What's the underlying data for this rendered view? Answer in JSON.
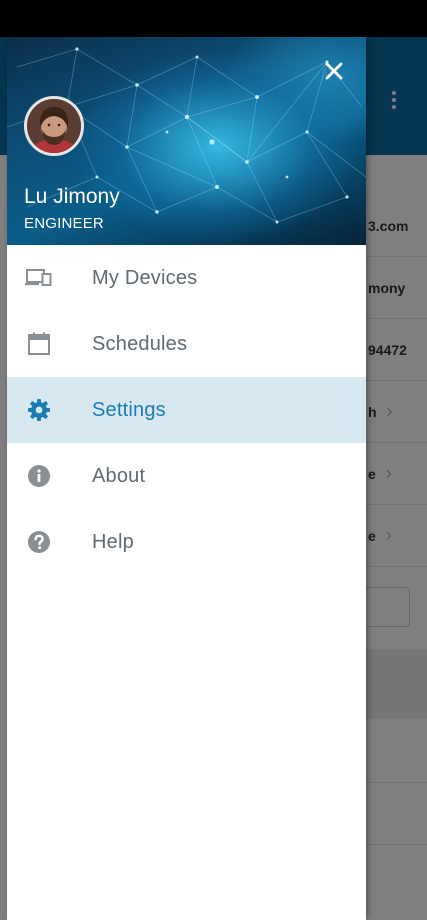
{
  "background": {
    "rows": [
      {
        "text": "3.com"
      },
      {
        "text": "mony"
      },
      {
        "text": "94472"
      },
      {
        "text": "h",
        "chevron": "›"
      },
      {
        "text": "e",
        "chevron": "›"
      },
      {
        "text": "e",
        "chevron": "›"
      }
    ]
  },
  "drawer": {
    "header": {
      "user_name": "Lu Jimony",
      "user_role": "ENGINEER",
      "close_icon": "close-icon"
    },
    "menu": [
      {
        "label": "My Devices",
        "icon": "devices-icon",
        "active": false
      },
      {
        "label": "Schedules",
        "icon": "calendar-icon",
        "active": false
      },
      {
        "label": "Settings",
        "icon": "gear-icon",
        "active": true
      },
      {
        "label": "About",
        "icon": "info-icon",
        "active": false
      },
      {
        "label": "Help",
        "icon": "help-icon",
        "active": false
      }
    ]
  },
  "colors": {
    "accent": "#1c7bb4",
    "active_bg": "#d8e8f1",
    "icon_gray": "#8a8f93",
    "text_gray": "#5f6b73",
    "app_bar": "#0a6aa1"
  }
}
